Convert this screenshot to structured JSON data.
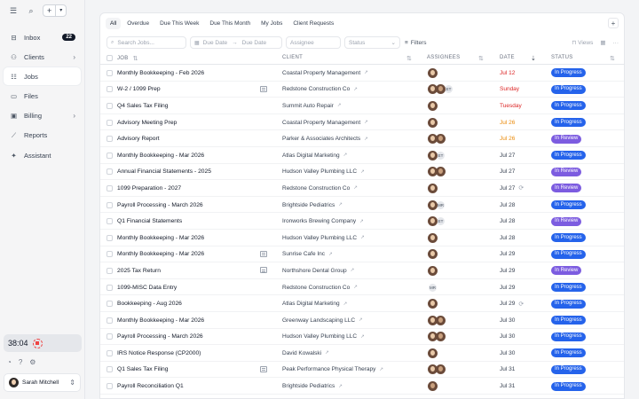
{
  "app": {
    "accent": "#2563eb",
    "review_color": "#7c5ce0"
  },
  "sidebar": {
    "items": [
      {
        "label": "Inbox",
        "icon": "inbox-icon",
        "badge": "22",
        "chevron": false,
        "active": false
      },
      {
        "label": "Clients",
        "icon": "users-icon",
        "badge": null,
        "chevron": true,
        "active": false
      },
      {
        "label": "Jobs",
        "icon": "jobs-list-icon",
        "badge": null,
        "chevron": false,
        "active": true
      },
      {
        "label": "Files",
        "icon": "file-icon",
        "badge": null,
        "chevron": false,
        "active": false
      },
      {
        "label": "Billing",
        "icon": "wallet-icon",
        "badge": null,
        "chevron": true,
        "active": false
      },
      {
        "label": "Reports",
        "icon": "chart-icon",
        "badge": null,
        "chevron": false,
        "active": false
      },
      {
        "label": "Assistant",
        "icon": "sparkle-icon",
        "badge": null,
        "chevron": false,
        "active": false
      }
    ],
    "timer": "38:04",
    "user": "Sarah Mitchell"
  },
  "tabs": [
    "All",
    "Overdue",
    "Due This Week",
    "Due This Month",
    "My Jobs",
    "Client Requests"
  ],
  "filters": {
    "search_placeholder": "Search Jobs...",
    "start_date": "Due Date",
    "end_date": "Due Date",
    "assignee": "Assignee",
    "status": "Status",
    "filters_label": "Filters",
    "views_label": "Views"
  },
  "columns": {
    "job": "JOB",
    "client": "CLIENT",
    "assignees": "ASSIGNEES",
    "date": "DATE",
    "status": "STATUS"
  },
  "rows": [
    {
      "job": "Monthly Bookkeeping - Feb 2026",
      "note": false,
      "client": "Coastal Property Management",
      "assignees": [
        "av-a"
      ],
      "date": "Jul 12",
      "date_color": "red",
      "recur": false,
      "status": "In Progress"
    },
    {
      "job": "W-2 / 1099 Prep",
      "note": true,
      "client": "Redstone Construction Co",
      "assignees": [
        "av-a",
        "av-b",
        "ET"
      ],
      "date": "Sunday",
      "date_color": "red",
      "recur": false,
      "status": "In Progress"
    },
    {
      "job": "Q4 Sales Tax Filing",
      "note": false,
      "client": "Summit Auto Repair",
      "assignees": [
        "av-a"
      ],
      "date": "Tuesday",
      "date_color": "red",
      "recur": false,
      "status": "In Progress"
    },
    {
      "job": "Advisory Meeting Prep",
      "note": false,
      "client": "Coastal Property Management",
      "assignees": [
        "av-a"
      ],
      "date": "Jul 26",
      "date_color": "orange",
      "recur": false,
      "status": "In Progress"
    },
    {
      "job": "Advisory Report",
      "note": false,
      "client": "Parker & Associates Architects",
      "assignees": [
        "av-a",
        "av-b"
      ],
      "date": "Jul 26",
      "date_color": "orange",
      "recur": false,
      "status": "In Review"
    },
    {
      "job": "Monthly Bookkeeping - Mar 2026",
      "note": false,
      "client": "Atlas Digital Marketing",
      "assignees": [
        "av-a",
        "ET"
      ],
      "date": "Jul 27",
      "date_color": "gray",
      "recur": false,
      "status": "In Progress"
    },
    {
      "job": "Annual Financial Statements - 2025",
      "note": false,
      "client": "Hudson Valley Plumbing LLC",
      "assignees": [
        "av-a",
        "av-b"
      ],
      "date": "Jul 27",
      "date_color": "gray",
      "recur": false,
      "status": "In Review"
    },
    {
      "job": "1099 Preparation - 2027",
      "note": false,
      "client": "Redstone Construction Co",
      "assignees": [
        "av-a"
      ],
      "date": "Jul 27",
      "date_color": "gray",
      "recur": true,
      "status": "In Review"
    },
    {
      "job": "Payroll Processing - March 2026",
      "note": false,
      "client": "Brightside Pediatrics",
      "assignees": [
        "av-a",
        "MR"
      ],
      "date": "Jul 28",
      "date_color": "gray",
      "recur": false,
      "status": "In Progress"
    },
    {
      "job": "Q1 Financial Statements",
      "note": false,
      "client": "Ironworks Brewing Company",
      "assignees": [
        "av-a",
        "ET"
      ],
      "date": "Jul 28",
      "date_color": "gray",
      "recur": false,
      "status": "In Review"
    },
    {
      "job": "Monthly Bookkeeping - Mar 2026",
      "note": false,
      "client": "Hudson Valley Plumbing LLC",
      "assignees": [
        "av-a"
      ],
      "date": "Jul 28",
      "date_color": "gray",
      "recur": false,
      "status": "In Progress"
    },
    {
      "job": "Monthly Bookkeeping - Mar 2026",
      "note": true,
      "client": "Sunrise Cafe Inc",
      "assignees": [
        "av-a"
      ],
      "date": "Jul 29",
      "date_color": "gray",
      "recur": false,
      "status": "In Progress"
    },
    {
      "job": "2025 Tax Return",
      "note": true,
      "client": "Northshore Dental Group",
      "assignees": [
        "av-a"
      ],
      "date": "Jul 29",
      "date_color": "gray",
      "recur": false,
      "status": "In Review"
    },
    {
      "job": "1099-MISC Data Entry",
      "note": false,
      "client": "Redstone Construction Co",
      "assignees": [
        "MR"
      ],
      "date": "Jul 29",
      "date_color": "gray",
      "recur": false,
      "status": "In Progress"
    },
    {
      "job": "Bookkeeping - Aug 2026",
      "note": false,
      "client": "Atlas Digital Marketing",
      "assignees": [
        "av-a"
      ],
      "date": "Jul 29",
      "date_color": "gray",
      "recur": true,
      "status": "In Progress"
    },
    {
      "job": "Monthly Bookkeeping - Mar 2026",
      "note": false,
      "client": "Greenway Landscaping LLC",
      "assignees": [
        "av-a",
        "av-b"
      ],
      "date": "Jul 30",
      "date_color": "gray",
      "recur": false,
      "status": "In Progress"
    },
    {
      "job": "Payroll Processing - March 2026",
      "note": false,
      "client": "Hudson Valley Plumbing LLC",
      "assignees": [
        "av-a",
        "av-b"
      ],
      "date": "Jul 30",
      "date_color": "gray",
      "recur": false,
      "status": "In Progress"
    },
    {
      "job": "IRS Notice Response (CP2000)",
      "note": false,
      "client": "David Kowalski",
      "assignees": [
        "av-a"
      ],
      "date": "Jul 30",
      "date_color": "gray",
      "recur": false,
      "status": "In Progress"
    },
    {
      "job": "Q1 Sales Tax Filing",
      "note": true,
      "client": "Peak Performance Physical Therapy",
      "assignees": [
        "av-a",
        "av-b"
      ],
      "date": "Jul 31",
      "date_color": "gray",
      "recur": false,
      "status": "In Progress"
    },
    {
      "job": "Payroll Reconciliation Q1",
      "note": false,
      "client": "Brightside Pediatrics",
      "assignees": [
        "av-b"
      ],
      "date": "Jul 31",
      "date_color": "gray",
      "recur": false,
      "status": "In Progress"
    }
  ]
}
